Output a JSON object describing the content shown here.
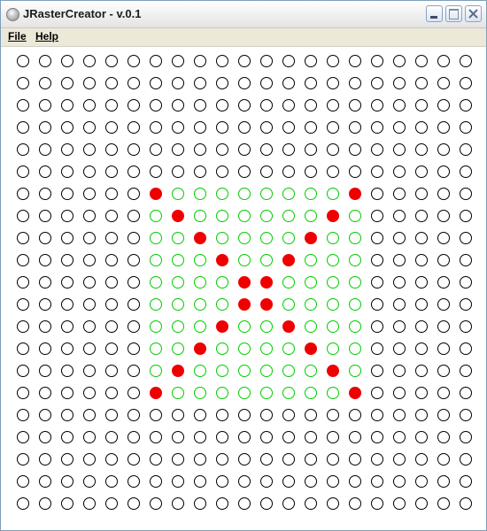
{
  "window": {
    "title": "JRasterCreator - v.0.1"
  },
  "menubar": {
    "items": [
      {
        "label": "File"
      },
      {
        "label": "Help"
      }
    ]
  },
  "raster": {
    "columns": 21,
    "rows": 21,
    "colors": {
      "empty_stroke": "#000000",
      "region_stroke": "#00cc00",
      "filled": "#ee0000",
      "background": "#ffffff"
    },
    "region": {
      "row_from": 6,
      "row_to": 15,
      "col_from": 6,
      "col_to": 15
    },
    "filled_cells": [
      [
        6,
        6
      ],
      [
        6,
        15
      ],
      [
        7,
        7
      ],
      [
        7,
        14
      ],
      [
        8,
        8
      ],
      [
        8,
        13
      ],
      [
        9,
        9
      ],
      [
        9,
        12
      ],
      [
        10,
        10
      ],
      [
        10,
        11
      ],
      [
        11,
        10
      ],
      [
        11,
        11
      ],
      [
        12,
        9
      ],
      [
        12,
        12
      ],
      [
        13,
        8
      ],
      [
        13,
        13
      ],
      [
        14,
        7
      ],
      [
        14,
        14
      ],
      [
        15,
        6
      ],
      [
        15,
        15
      ]
    ]
  }
}
